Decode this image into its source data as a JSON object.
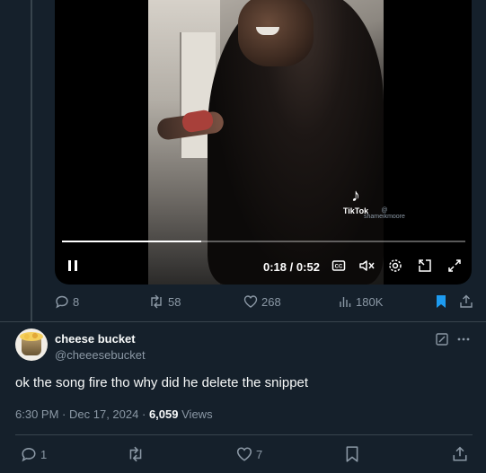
{
  "video": {
    "watermark_brand": "TikTok",
    "watermark_handle": "@ shameikmoore",
    "current_time": "0:18",
    "separator": "/",
    "duration": "0:52",
    "progress_fraction": 0.346,
    "icons": [
      "pause-icon",
      "captions-icon",
      "muted-volume-icon",
      "settings-icon",
      "picture-in-picture-icon",
      "fullscreen-icon"
    ]
  },
  "tweet_actions": {
    "replies": "8",
    "retweets": "58",
    "likes": "268",
    "views": "180K"
  },
  "reply": {
    "display_name": "cheese bucket",
    "handle": "@cheeesebucket",
    "text": "ok the song fire tho why did he delete the snippet",
    "time": "6:30 PM",
    "dot": "·",
    "date": "Dec 17, 2024",
    "views_count": "6,059",
    "views_label": "Views",
    "actions": {
      "replies": "1",
      "retweets": "",
      "likes": "7"
    }
  },
  "colors": {
    "background": "#15202b",
    "muted_text": "#8b98a5",
    "primary_text": "#f7f9f9",
    "bookmark_active": "#1d9bf0",
    "divider": "#38444d"
  }
}
